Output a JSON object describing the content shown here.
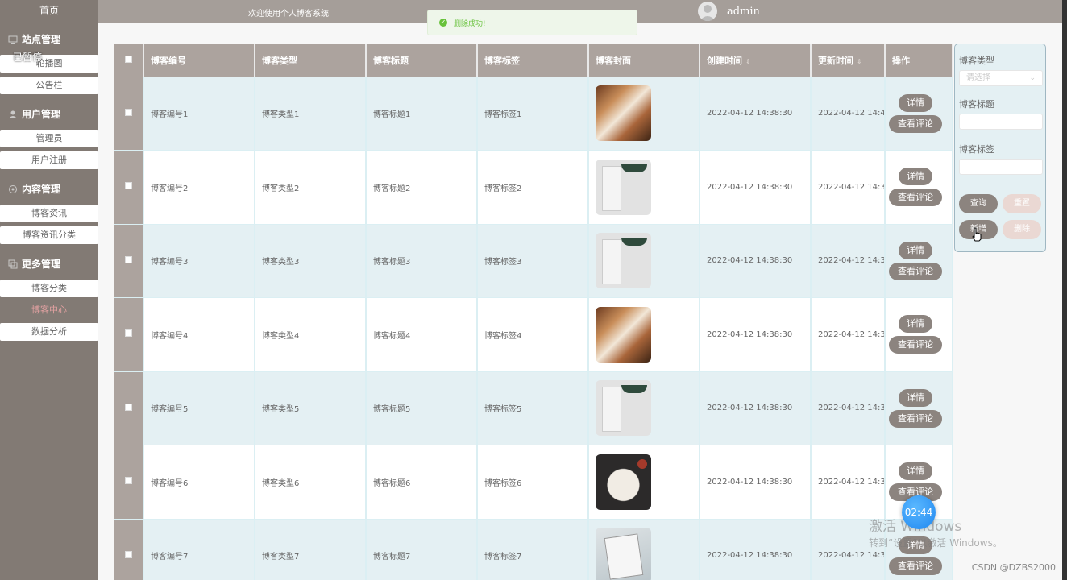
{
  "sidebar": {
    "home": "首页",
    "paused_label": "已暂停",
    "groups": [
      {
        "title": "站点管理",
        "icon": "monitor-icon",
        "items": [
          "轮播图",
          "公告栏"
        ]
      },
      {
        "title": "用户管理",
        "icon": "user-icon",
        "items": [
          "管理员",
          "用户注册"
        ]
      },
      {
        "title": "内容管理",
        "icon": "content-icon",
        "items": [
          "博客资讯",
          "博客资讯分类"
        ]
      },
      {
        "title": "更多管理",
        "icon": "more-icon",
        "items": [
          "博客分类",
          "博客中心",
          "数据分析"
        ]
      }
    ]
  },
  "topbar": {
    "welcome": "欢迎使用个人博客系统",
    "username": "admin"
  },
  "toast": {
    "message": "删除成功!"
  },
  "table": {
    "headers": [
      "博客编号",
      "博客类型",
      "博客标题",
      "博客标签",
      "博客封面",
      "创建时间",
      "更新时间",
      "操作"
    ],
    "detail_label": "详情",
    "comments_label": "查看评论",
    "rows": [
      {
        "id": "博客编号1",
        "type": "博客类型1",
        "title": "博客标题1",
        "tag": "博客标签1",
        "cover": "food",
        "created": "2022-04-12 14:38:30",
        "updated": "2022-04-12 14:4"
      },
      {
        "id": "博客编号2",
        "type": "博客类型2",
        "title": "博客标题2",
        "tag": "博客标签2",
        "cover": "book",
        "created": "2022-04-12 14:38:30",
        "updated": "2022-04-12 14:3"
      },
      {
        "id": "博客编号3",
        "type": "博客类型3",
        "title": "博客标题3",
        "tag": "博客标签3",
        "cover": "book",
        "created": "2022-04-12 14:38:30",
        "updated": "2022-04-12 14:3"
      },
      {
        "id": "博客编号4",
        "type": "博客类型4",
        "title": "博客标题4",
        "tag": "博客标签4",
        "cover": "food",
        "created": "2022-04-12 14:38:30",
        "updated": "2022-04-12 14:3"
      },
      {
        "id": "博客编号5",
        "type": "博客类型5",
        "title": "博客标题5",
        "tag": "博客标签5",
        "cover": "book",
        "created": "2022-04-12 14:38:30",
        "updated": "2022-04-12 14:3"
      },
      {
        "id": "博客编号6",
        "type": "博客类型6",
        "title": "博客标题6",
        "tag": "博客标签6",
        "cover": "reading",
        "created": "2022-04-12 14:38:30",
        "updated": "2022-04-12 14:3"
      },
      {
        "id": "博客编号7",
        "type": "博客类型7",
        "title": "博客标题7",
        "tag": "博客标签7",
        "cover": "spread",
        "created": "2022-04-12 14:38:30",
        "updated": "2022-04-12 14:3"
      }
    ]
  },
  "filter": {
    "type_label": "博客类型",
    "type_placeholder": "请选择",
    "title_label": "博客标题",
    "tag_label": "博客标签",
    "search_label": "查询",
    "reset_label": "重置",
    "add_label": "新增",
    "delete_label": "删除"
  },
  "overlay": {
    "timer": "02:44",
    "watermark_line1": "激活 Windows",
    "watermark_line2": "转到“设置”以激活 Windows。",
    "csdn": "CSDN @DZBS2000"
  }
}
